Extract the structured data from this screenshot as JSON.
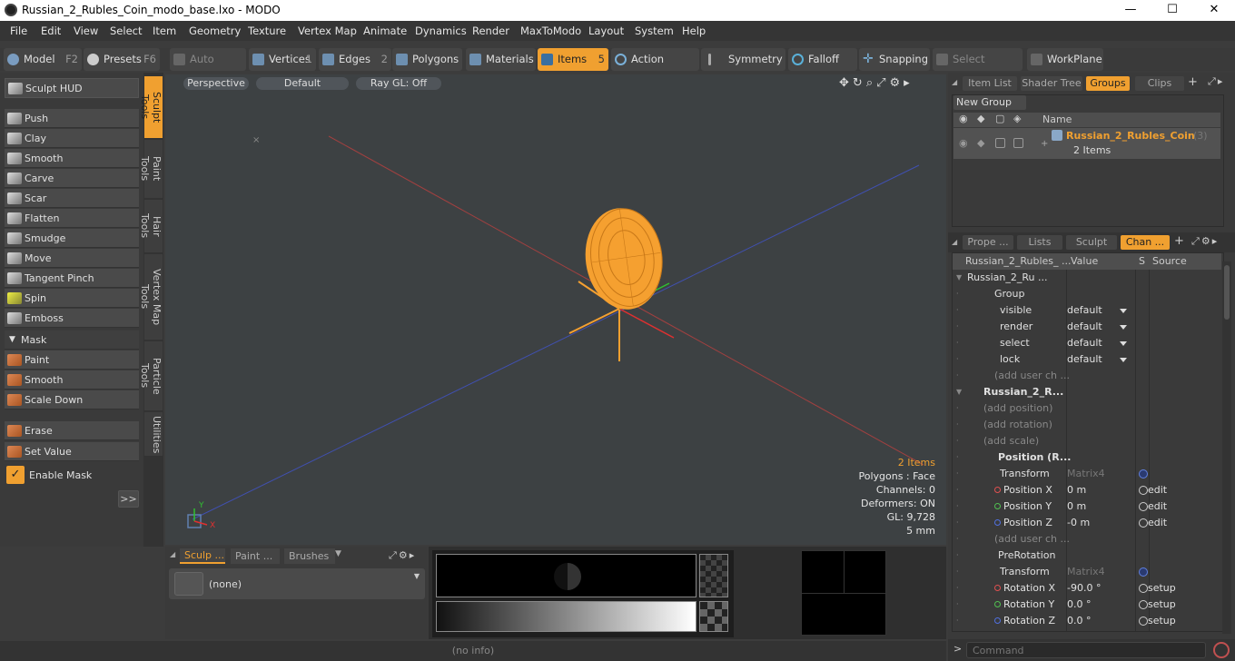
{
  "window": {
    "title": "Russian_2_Rubles_Coin_modo_base.lxo - MODO",
    "minimize": "—",
    "maximize": "☐",
    "close": "✕"
  },
  "menu": [
    "File",
    "Edit",
    "View",
    "Select",
    "Item",
    "Geometry",
    "Texture",
    "Vertex Map",
    "Animate",
    "Dynamics",
    "Render",
    "MaxToModo",
    "Layout",
    "System",
    "Help"
  ],
  "toolbar": {
    "model": "Model",
    "model_key": "F2",
    "presets": "Presets",
    "presets_key": "F6",
    "auto_select": "Auto Select",
    "vertices": "Vertices",
    "vertices_key": "1",
    "edges": "Edges",
    "edges_key": "2",
    "polygons": "Polygons",
    "materials": "Materials",
    "items": "Items",
    "items_key": "5",
    "action_center": "Action Center",
    "symmetry": "Symmetry",
    "falloff": "Falloff",
    "snapping": "Snapping",
    "select_through": "Select Through",
    "workplane": "WorkPlane"
  },
  "left_panel": {
    "hud": "Sculpt HUD",
    "tools": [
      "Push",
      "Clay",
      "Smooth",
      "Carve",
      "Scar",
      "Flatten",
      "Smudge",
      "Move",
      "Tangent Pinch",
      "Spin",
      "Emboss"
    ],
    "mask_header": "Mask",
    "mask_tools": [
      "Paint",
      "Smooth",
      "Scale Down"
    ],
    "extra_tools": [
      "Erase",
      "Set Value"
    ],
    "enable_mask": "Enable Mask",
    "expand": ">>"
  },
  "vertical_tabs": [
    "Sculpt Tools",
    "Paint Tools",
    "Hair Tools",
    "Vertex Map Tools",
    "Particle Tools",
    "Utilities"
  ],
  "viewport": {
    "view": "Perspective",
    "shading": "Default",
    "raygl": "Ray GL: Off",
    "info": {
      "items": "2 Items",
      "polygons": "Polygons : Face",
      "channels": "Channels: 0",
      "deformers": "Deformers: ON",
      "gl": "GL: 9,728",
      "scale": "5 mm"
    },
    "axis_y": "Y",
    "axis_x": "X"
  },
  "bottom_panel": {
    "tabs": [
      "Sculp ...",
      "Paint ...",
      "Brushes"
    ],
    "preset": "(none)"
  },
  "status": "(no info)",
  "command_placeholder": "Command",
  "colors": {
    "accent": "#f0a030",
    "mesh": "#f5a030",
    "x_axis": "#c04040",
    "z_axis": "#4050c0"
  },
  "right_panel": {
    "top_tabs": [
      "Item List",
      "Shader Tree",
      "Groups",
      "Clips"
    ],
    "new_group": "New Group",
    "name_col": "Name",
    "group_name": "Russian_2_Rubles_Coin",
    "group_count": "(3)",
    "group_items": "2 Items",
    "mid_tabs": [
      "Prope ...",
      "Lists",
      "Sculpt",
      "Chan ..."
    ],
    "chan_cols": [
      "Russian_2_Rubles_ ...",
      "Value",
      "S",
      "Source"
    ],
    "channels": [
      {
        "name": "Russian_2_Ru ...",
        "value": "",
        "source": "",
        "indent": 16,
        "bold": false
      },
      {
        "name": "Group",
        "value": "",
        "source": "",
        "indent": 46,
        "bold": false
      },
      {
        "name": "visible",
        "value": "default",
        "source": "",
        "indent": 52,
        "dd": true
      },
      {
        "name": "render",
        "value": "default",
        "source": "",
        "indent": 52,
        "dd": true
      },
      {
        "name": "select",
        "value": "default",
        "source": "",
        "indent": 52,
        "dd": true
      },
      {
        "name": "lock",
        "value": "default",
        "source": "",
        "indent": 52,
        "dd": true
      },
      {
        "name": "(add user ch ...",
        "value": "",
        "source": "",
        "indent": 46,
        "dim": true
      },
      {
        "name": "Russian_2_R...",
        "value": "",
        "source": "",
        "indent": 34,
        "bold": true
      },
      {
        "name": "(add position)",
        "value": "",
        "source": "",
        "indent": 34,
        "dim": true
      },
      {
        "name": "(add rotation)",
        "value": "",
        "source": "",
        "indent": 34,
        "dim": true
      },
      {
        "name": "(add scale)",
        "value": "",
        "source": "",
        "indent": 34,
        "dim": true
      },
      {
        "name": "Position (R...",
        "value": "",
        "source": "",
        "indent": 50,
        "bold": true
      },
      {
        "name": "Transform",
        "value": "Matrix4",
        "source": "",
        "indent": 52,
        "dimval": true,
        "gear": true
      },
      {
        "name": "Position X",
        "value": "0 m",
        "source": "edit",
        "indent": 46,
        "dotc": "#e05050",
        "circ": true
      },
      {
        "name": "Position Y",
        "value": "0 m",
        "source": "edit",
        "indent": 46,
        "dotc": "#50c050",
        "circ": true
      },
      {
        "name": "Position Z",
        "value": "-0 m",
        "source": "edit",
        "indent": 46,
        "dotc": "#5070e0",
        "circ": true
      },
      {
        "name": "(add user ch ...",
        "value": "",
        "source": "",
        "indent": 46,
        "dim": true
      },
      {
        "name": "PreRotation",
        "value": "",
        "source": "",
        "indent": 50,
        "bold": false
      },
      {
        "name": "Transform",
        "value": "Matrix4",
        "source": "",
        "indent": 52,
        "dimval": true,
        "gear": true
      },
      {
        "name": "Rotation X",
        "value": "-90.0 °",
        "source": "setup",
        "indent": 46,
        "dotc": "#e05050",
        "circ": true
      },
      {
        "name": "Rotation Y",
        "value": "0.0 °",
        "source": "setup",
        "indent": 46,
        "dotc": "#50c050",
        "circ": true
      },
      {
        "name": "Rotation Z",
        "value": "0.0 °",
        "source": "setup",
        "indent": 46,
        "dotc": "#5070e0",
        "circ": true
      }
    ]
  }
}
